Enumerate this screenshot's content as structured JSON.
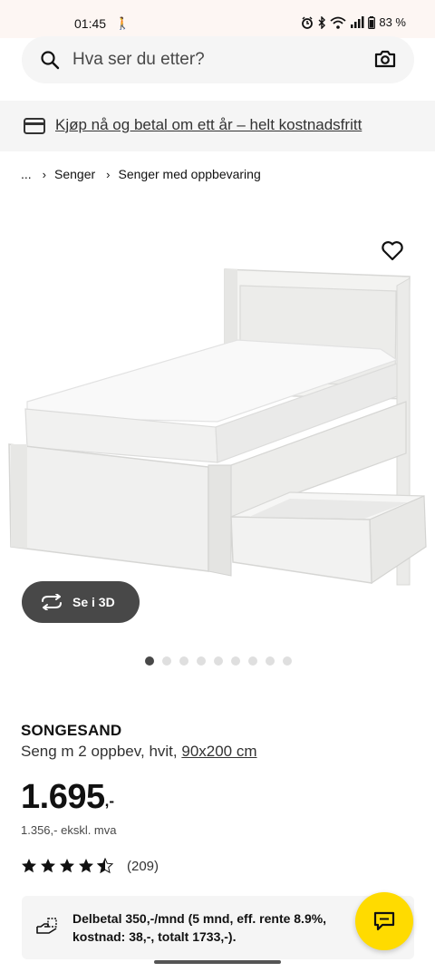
{
  "status_bar": {
    "time": "01:45",
    "battery": "83 %"
  },
  "search": {
    "placeholder": "Hva ser du etter?"
  },
  "promo": {
    "text": "Kjøp nå og betal om ett år – helt kostnadsfritt"
  },
  "breadcrumb": {
    "ellipsis": "...",
    "items": [
      "Senger",
      "Senger med oppbevaring"
    ]
  },
  "media": {
    "view_3d_label": "Se i 3D",
    "total_images": 9,
    "active_image": 1
  },
  "product": {
    "name": "SONGESAND",
    "description": "Seng m 2 oppbev, hvit, ",
    "size": "90x200 cm",
    "price_main": "1.695",
    "price_suffix": ",-",
    "price_ex_vat": "1.356,- ekskl. mva",
    "rating_value": 4.5,
    "rating_max": 5,
    "review_count": "(209)"
  },
  "installment": {
    "text": "Delbetal 350,-/mnd (5 mnd, eff. rente 8.9%, kostnad: 38,-, totalt 1733,-)."
  },
  "colors": {
    "accent_yellow": "#ffdb00",
    "dark_gray": "#484848",
    "light_gray": "#f5f5f5",
    "status_bar_bg": "#fdf6f3"
  },
  "icons": {
    "search": "search-icon",
    "camera": "camera-icon",
    "card": "credit-card-icon",
    "heart": "heart-icon",
    "rotate": "rotate-3d-icon",
    "chat": "chat-icon",
    "installment": "payment-hand-icon"
  }
}
